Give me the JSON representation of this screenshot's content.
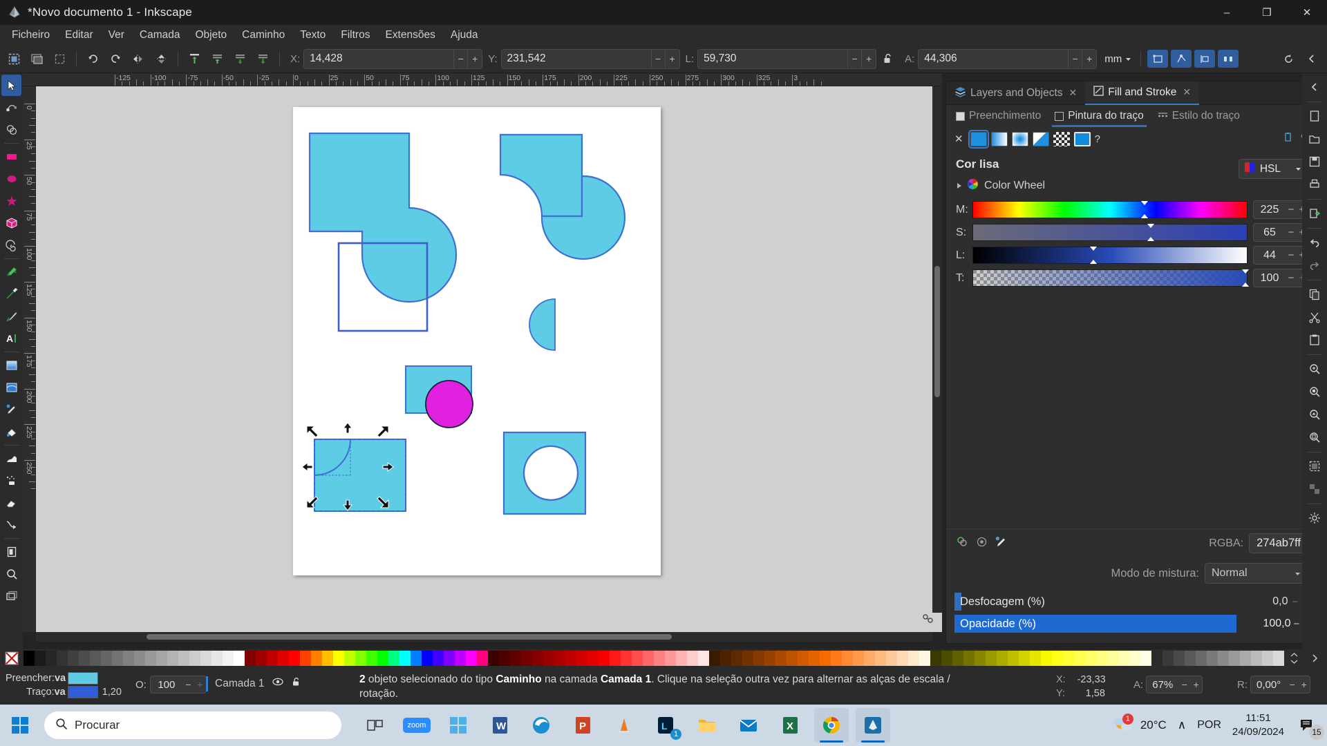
{
  "window": {
    "title": "*Novo documento 1 - Inkscape",
    "minimize": "–",
    "maximize": "❐",
    "close": "✕"
  },
  "menubar": {
    "items": [
      {
        "label": "Ficheiro"
      },
      {
        "label": "Editar"
      },
      {
        "label": "Ver"
      },
      {
        "label": "Camada"
      },
      {
        "label": "Objeto"
      },
      {
        "label": "Caminho"
      },
      {
        "label": "Texto"
      },
      {
        "label": "Filtros"
      },
      {
        "label": "Extensões"
      },
      {
        "label": "Ajuda"
      }
    ]
  },
  "toolbar": {
    "x_label": "X:",
    "x_value": "14,428",
    "y_label": "Y:",
    "y_value": "231,542",
    "w_label": "L:",
    "w_value": "59,730",
    "h_label": "A:",
    "h_value": "44,306",
    "unit": "mm",
    "minus": "−",
    "plus": "+",
    "lock_icon": "lock-open-icon"
  },
  "rulers": {
    "horizontal": [
      "-125",
      "-100",
      "-75",
      "-50",
      "-25",
      "0",
      "25",
      "50",
      "75",
      "100",
      "125",
      "150",
      "175",
      "200",
      "225",
      "250",
      "275",
      "300",
      "325",
      "3"
    ],
    "vertical": [
      "0",
      "25",
      "50",
      "75",
      "100",
      "125",
      "150",
      "175",
      "200",
      "225",
      "250"
    ]
  },
  "dock": {
    "tabs": [
      {
        "label": "Layers and Objects",
        "icon": "layers-icon",
        "close": "✕",
        "active": false
      },
      {
        "label": "Fill and Stroke",
        "icon": "fillstroke-icon",
        "close": "✕",
        "active": true
      }
    ],
    "chevron": "▾"
  },
  "fillstroke": {
    "tabs": [
      {
        "label": "Preenchimento",
        "active": false
      },
      {
        "label": "Pintura do traço",
        "active": true
      },
      {
        "label": "Estilo do traço",
        "active": false
      }
    ],
    "paint_types": [
      "flat-color",
      "linear-gradient",
      "radial-gradient",
      "pattern",
      "swatch",
      "unknown"
    ],
    "help_glyph": "?",
    "none_glyph": "✕",
    "heading": "Cor lisa",
    "mode_label": "HSL",
    "color_wheel_label": "Color Wheel",
    "sliders": [
      {
        "label": "M:",
        "value": "225",
        "pos_pct": 62.5
      },
      {
        "label": "S:",
        "value": "65",
        "pos_pct": 65
      },
      {
        "label": "L:",
        "value": "44",
        "pos_pct": 44
      },
      {
        "label": "T:",
        "value": "100",
        "pos_pct": 100
      }
    ],
    "rgba_label": "RGBA:",
    "rgba_value": "274ab7ff",
    "blend_label": "Modo de mistura:",
    "blend_value": "Normal",
    "blur_label": "Desfocagem (%)",
    "blur_value": "0,0",
    "opacity_label": "Opacidade (%)",
    "opacity_value": "100,0",
    "minus": "−",
    "plus": "+"
  },
  "statusbar": {
    "fill_label": "Preencher:",
    "fill_value": "va",
    "fill_color": "#5ecce5",
    "stroke_label": "Traço:",
    "stroke_value": "va",
    "stroke_color": "#2f5ed8",
    "stroke_width": "1,20",
    "opacity_label": "O:",
    "opacity_value": "100",
    "layer_name": "Camada 1",
    "message_count": "2",
    "message": " objeto selecionado do tipo ",
    "message_type": "Caminho",
    "message_mid": " na camada ",
    "message_layer": "Camada 1",
    "message_tail": ". Clique na seleção outra vez para alternar as alças de escala / rotação.",
    "x_label": "X:",
    "x_value": "-23,33",
    "y_label": "Y:",
    "y_value": "1,58",
    "zoom_label": "A:",
    "zoom_value": "67%",
    "rotate_label": "R:",
    "rotate_value": "0,00°",
    "minus": "−",
    "plus": "+"
  },
  "canvas": {
    "background": "#d0d0d0",
    "page_background": "#ffffff",
    "shape_fill": "#5ecce5",
    "shape_stroke": "#3f6fd0",
    "magenta_fill": "#e022e0",
    "shapes": [
      {
        "name": "union-square-circle",
        "type": "path"
      },
      {
        "name": "difference-square-circle",
        "type": "path"
      },
      {
        "name": "empty-square-outline",
        "type": "rect"
      },
      {
        "name": "lens-sliver",
        "type": "path"
      },
      {
        "name": "rect-with-magenta-circle",
        "type": "group"
      },
      {
        "name": "selected-rect-with-arc",
        "type": "path",
        "selected": true
      },
      {
        "name": "square-with-white-circle",
        "type": "path"
      }
    ]
  },
  "taskbar": {
    "search_placeholder": "Procurar",
    "apps": [
      "task-view",
      "zoom",
      "store",
      "word",
      "edge",
      "powerpoint",
      "vlc",
      "lightroom",
      "explorer",
      "mail",
      "excel",
      "chrome",
      "inkscape"
    ],
    "zoom_label": "zoom",
    "lightroom_badge": "1",
    "temperature": "20°C",
    "language": "POR",
    "time": "11:51",
    "date": "24/09/2024",
    "notification_count": "15",
    "weather_badge": "1",
    "chevron": "∧"
  }
}
